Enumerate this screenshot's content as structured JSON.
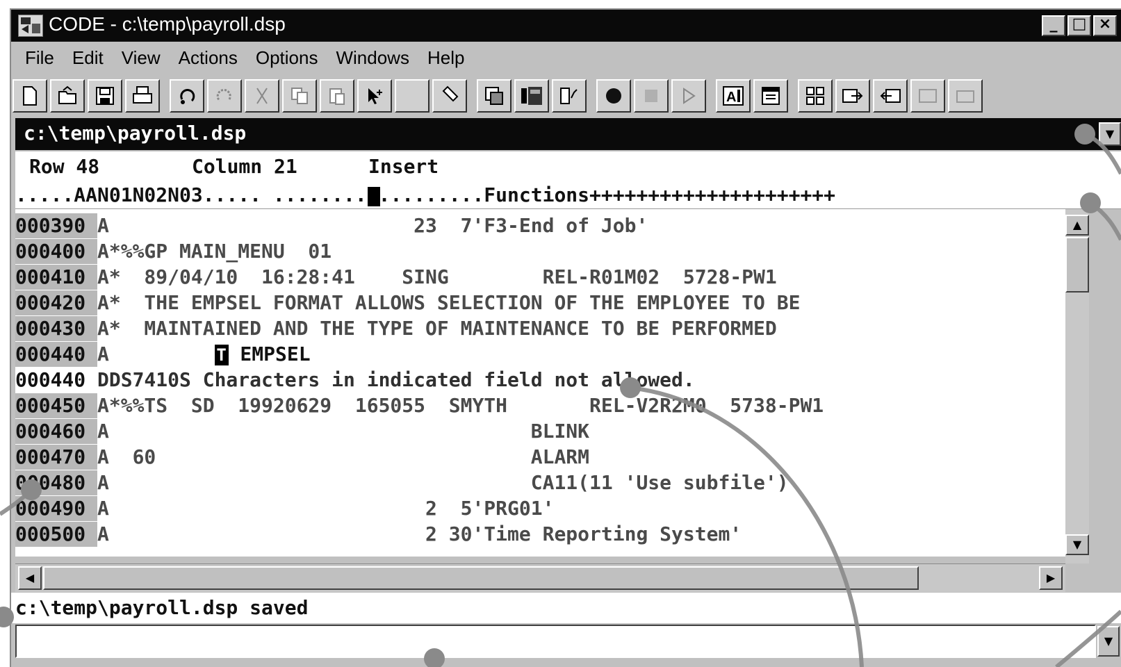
{
  "window": {
    "title": "CODE - c:\\temp\\payroll.dsp",
    "buttons": {
      "minimize": "_",
      "maximize": "□",
      "close": "×"
    }
  },
  "menu": [
    "File",
    "Edit",
    "View",
    "Actions",
    "Options",
    "Windows",
    "Help"
  ],
  "toolbar_icons": [
    "new-file-icon",
    "open-file-icon",
    "save-icon",
    "print-icon",
    "undo-icon",
    "redo-icon",
    "cut-icon",
    "copy-icon",
    "paste-icon",
    "select-arrow-icon",
    "blank-icon",
    "highlighter-icon",
    "window-list-icon",
    "prompt-icon",
    "verify-icon",
    "record-icon",
    "stop-icon",
    "play-icon",
    "font-icon",
    "calendar-icon",
    "tile-icon",
    "export-icon",
    "import-icon",
    "disabled-tool-icon",
    "disabled-tool-2-icon"
  ],
  "path_bar": {
    "path": "c:\\temp\\payroll.dsp"
  },
  "status": {
    "row": "Row 48",
    "column": "Column 21",
    "mode": "Insert"
  },
  "ruler": ".....AAN01N02N03..... ..................Functions+++++++++++++++++++++",
  "lines": [
    {
      "seq": "000390",
      "text": "A                          23  7'F3-End of Job'"
    },
    {
      "seq": "000400",
      "text": "A*%%GP MAIN_MENU  01"
    },
    {
      "seq": "000410",
      "text": "A*  89/04/10  16:28:41    SING        REL-R01M02  5728-PW1"
    },
    {
      "seq": "000420",
      "text": "A*  THE EMPSEL FORMAT ALLOWS SELECTION OF THE EMPLOYEE TO BE"
    },
    {
      "seq": "000430",
      "text": "A*  MAINTAINED AND THE TYPE OF MAINTENANCE TO BE PERFORMED"
    },
    {
      "seq": "000440",
      "text_before": "A         ",
      "cursor": "T",
      "text_after": " EMPSEL"
    },
    {
      "seq": "000440",
      "text": "DDS7410S Characters in indicated field not allowed.",
      "error": true
    },
    {
      "seq": "000450",
      "text": "A*%%TS  SD  19920629  165055  SMYTH       REL-V2R2M0  5738-PW1"
    },
    {
      "seq": "000460",
      "text": "A                                    BLINK"
    },
    {
      "seq": "000470",
      "text": "A  60                                ALARM"
    },
    {
      "seq": "000480",
      "text": "A                                    CA11(11 'Use subfile')"
    },
    {
      "seq": "000490",
      "text": "A                           2  5'PRG01'"
    },
    {
      "seq": "000500",
      "text": "A                           2 30'Time Reporting System'"
    }
  ],
  "message": "c:\\temp\\payroll.dsp saved",
  "command_line": {
    "value": ""
  }
}
